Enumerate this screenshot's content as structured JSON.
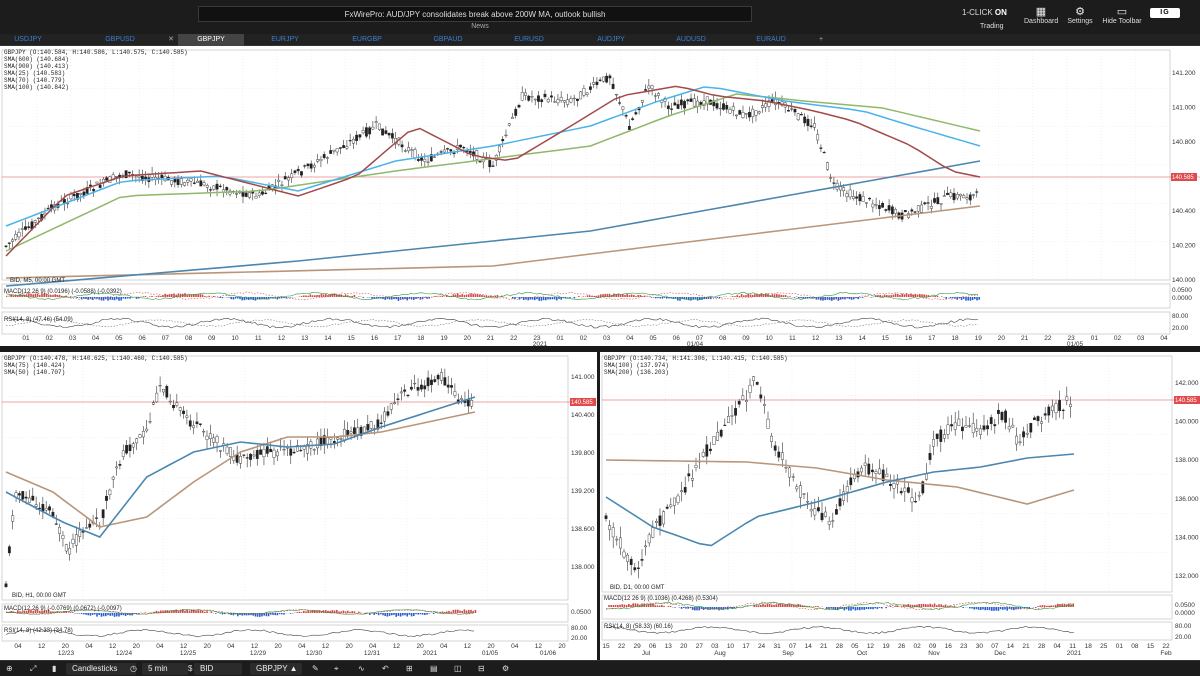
{
  "topbar": {
    "news_text": "FxWirePro: AUD/JPY consolidates break above 200W MA, outlook bullish",
    "news_label": "News",
    "one_click_prefix": "1-CLICK",
    "one_click_state": "ON",
    "trading_label": "Trading",
    "dashboard_label": "Dashboard",
    "settings_label": "Settings",
    "hide_toolbar_label": "Hide Toolbar",
    "logo_text": "IG"
  },
  "tabs": [
    {
      "label": "USDJPY"
    },
    {
      "label": "GBPUSD"
    },
    {
      "label": "GBPJPY",
      "active": true
    },
    {
      "label": "EURJPY"
    },
    {
      "label": "EURGBP"
    },
    {
      "label": "GBPAUD"
    },
    {
      "label": "EURUSD"
    },
    {
      "label": "AUDJPY"
    },
    {
      "label": "AUDUSD"
    },
    {
      "label": "EURAUD"
    }
  ],
  "pane_top": {
    "legend": [
      "GBPJPY (O:140.584, H:140.586, L:140.575, C:140.585)",
      "SMA(600) (140.684)",
      "SMA(900) (140.413)",
      "SMA(25) (140.583)",
      "SMA(70) (140.779)",
      "SMA(100) (140.842)"
    ],
    "bid_label": "BID, M5, 00:00 GMT",
    "macd_label": "MACD(12 26 9) (0.0196) (-0.0588) (-0.0392)",
    "rsi_label": "RSI(14, 8) (47.46) (54.09)",
    "price_ticks": [
      "141.200",
      "141.000",
      "140.800",
      "140.600",
      "140.400",
      "140.200",
      "140.000"
    ],
    "current_price": "140.585",
    "macd_ticks": [
      "0.0500",
      "0.0000"
    ],
    "rsi_ticks": [
      "80.00",
      "20.00"
    ],
    "time_ticks": [
      "01",
      "02",
      "03",
      "04",
      "05",
      "06",
      "07",
      "08",
      "09",
      "10",
      "11",
      "12",
      "13",
      "14",
      "15",
      "16",
      "17",
      "18",
      "19",
      "20",
      "21",
      "22",
      "23",
      "01",
      "02",
      "03",
      "04",
      "05",
      "06",
      "07",
      "08",
      "09",
      "10",
      "11",
      "12",
      "13",
      "14",
      "15",
      "16",
      "17",
      "18",
      "19",
      "20",
      "21",
      "22",
      "23",
      "01",
      "02",
      "03",
      "04"
    ],
    "date_labels": [
      "2021",
      "01/04",
      "01/05"
    ]
  },
  "pane_left": {
    "legend": [
      "GBPJPY (O:140.478, H:140.625, L:140.460, C:140.585)",
      "SMA(75) (140.424)",
      "SMA(50) (140.707)"
    ],
    "bid_label": "BID, H1, 00:00 GMT",
    "macd_label": "MACD(12 26 9) (-0.0769) (0.0672) (-0.0097)",
    "rsi_label": "RSI(14, 8) (42.33) (34.78)",
    "price_ticks": [
      "141.000",
      "140.400",
      "139.800",
      "139.200",
      "138.600",
      "138.000"
    ],
    "current_price": "140.585",
    "macd_ticks": [
      "0.0500"
    ],
    "rsi_ticks": [
      "80.00",
      "20.00"
    ],
    "time_ticks": [
      "04",
      "12",
      "20",
      "04",
      "12",
      "20",
      "04",
      "12",
      "20",
      "04",
      "12",
      "20",
      "04",
      "12",
      "20",
      "04",
      "12",
      "20",
      "04",
      "12",
      "20",
      "04",
      "12",
      "20"
    ],
    "date_labels": [
      "12/23",
      "12/24",
      "12/25",
      "12/29",
      "12/30",
      "12/31",
      "2021",
      "01/05",
      "01/06"
    ]
  },
  "pane_right": {
    "legend": [
      "GBPJPY (O:140.734, H:141.306, L:140.415, C:140.585)",
      "SMA(100) (137.974)",
      "SMA(200) (136.203)"
    ],
    "bid_label": "BID, D1, 00:00 GMT",
    "macd_label": "MACD(12 26 9) (0.1036) (0.4268) (0.5304)",
    "rsi_label": "RSI(14, 8) (58.33) (60.16)",
    "price_ticks": [
      "142.000",
      "140.000",
      "138.000",
      "136.000",
      "134.000",
      "132.000"
    ],
    "current_price": "140.585",
    "macd_ticks": [
      "0.0500",
      "0.0000"
    ],
    "rsi_ticks": [
      "80.00",
      "20.00"
    ],
    "time_ticks": [
      "15",
      "22",
      "29",
      "06",
      "13",
      "20",
      "27",
      "03",
      "10",
      "17",
      "24",
      "31",
      "07",
      "14",
      "21",
      "28",
      "05",
      "12",
      "19",
      "26",
      "02",
      "09",
      "16",
      "23",
      "30",
      "07",
      "14",
      "21",
      "28",
      "04",
      "11",
      "18",
      "25",
      "01",
      "08",
      "15",
      "22"
    ],
    "date_labels": [
      "Jul",
      "Aug",
      "Sep",
      "Oct",
      "Nov",
      "Dec",
      "2021",
      "Feb"
    ]
  },
  "bottombar": {
    "chart_type": "Candlesticks",
    "interval": "5 min",
    "price_type": "BID",
    "instrument": "GBPJPY"
  },
  "colors": {
    "candle": "#333333",
    "sma_red": "#a24a4a",
    "sma_green": "#8fb86a",
    "sma_cyan": "#4ab3ea",
    "sma_blue": "#4a86b0",
    "sma_tan": "#b9967a",
    "price_line": "#e04a4a"
  }
}
